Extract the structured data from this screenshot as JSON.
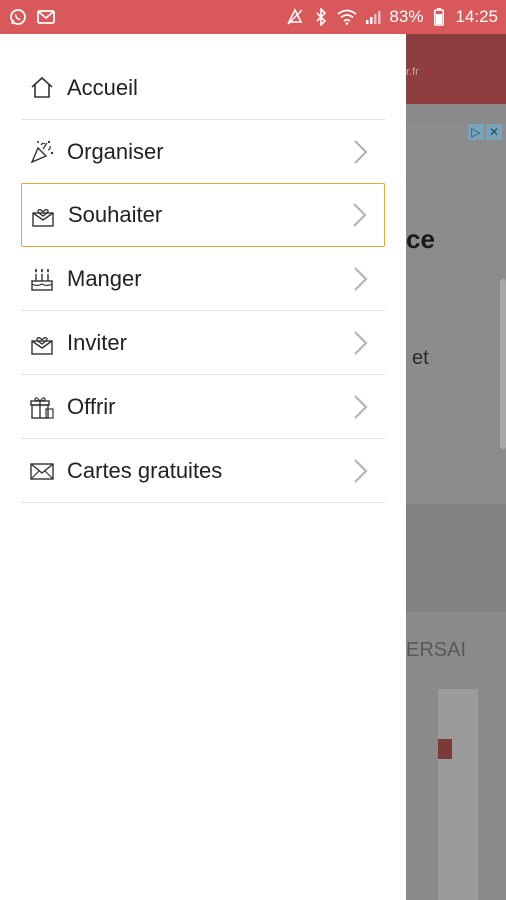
{
  "status_bar": {
    "battery": "83%",
    "time": "14:25",
    "icons": [
      "whatsapp-icon",
      "gmail-icon",
      "mute-icon",
      "bluetooth-icon",
      "wifi-icon",
      "signal-icon",
      "battery-icon"
    ]
  },
  "menu": {
    "items": [
      {
        "label": "Accueil",
        "icon": "home-icon"
      },
      {
        "label": "Organiser",
        "icon": "confetti-icon"
      },
      {
        "label": "Souhaiter",
        "icon": "envelope-heart-icon"
      },
      {
        "label": "Manger",
        "icon": "cake-icon"
      },
      {
        "label": "Inviter",
        "icon": "envelope-heart-icon"
      },
      {
        "label": "Offrir",
        "icon": "gift-icon"
      },
      {
        "label": "Cartes gratuites",
        "icon": "mail-icon"
      }
    ],
    "selected": "Souhaiter"
  },
  "background": {
    "header_fragment": "r.fr",
    "ad_choice": "▷",
    "ad_close": "✕",
    "text_ce": "ce",
    "text_et": "et",
    "text_ersai": "ERSAI"
  },
  "colors": {
    "status_bar": "#d9585a",
    "selected_border": "#e6a93c"
  }
}
